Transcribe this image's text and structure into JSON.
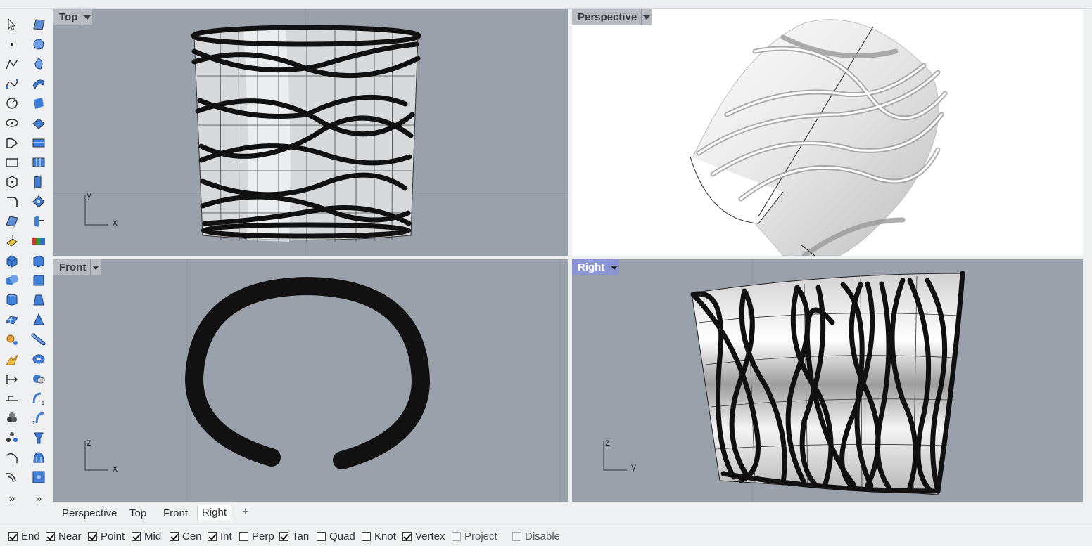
{
  "viewports": {
    "top": {
      "label": "Top",
      "axis_v": "y",
      "axis_h": "x"
    },
    "perspective": {
      "label": "Perspective"
    },
    "front": {
      "label": "Front",
      "axis_v": "z",
      "axis_h": "x"
    },
    "right": {
      "label": "Right",
      "axis_v": "z",
      "axis_h": "y"
    }
  },
  "viewport_tabs": [
    {
      "label": "Perspective",
      "active": false
    },
    {
      "label": "Top",
      "active": false
    },
    {
      "label": "Front",
      "active": false
    },
    {
      "label": "Right",
      "active": true
    }
  ],
  "add_tab_icon": "+",
  "toolbar": {
    "more_glyph": "»"
  },
  "osnaps": [
    {
      "label": "End",
      "checked": true,
      "enabled": true
    },
    {
      "label": "Near",
      "checked": true,
      "enabled": true
    },
    {
      "label": "Point",
      "checked": true,
      "enabled": true
    },
    {
      "label": "Mid",
      "checked": true,
      "enabled": true
    },
    {
      "label": "Cen",
      "checked": true,
      "enabled": true
    },
    {
      "label": "Int",
      "checked": true,
      "enabled": true
    },
    {
      "label": "Perp",
      "checked": false,
      "enabled": true
    },
    {
      "label": "Tan",
      "checked": true,
      "enabled": true
    },
    {
      "label": "Quad",
      "checked": false,
      "enabled": true
    },
    {
      "label": "Knot",
      "checked": false,
      "enabled": true
    },
    {
      "label": "Vertex",
      "checked": true,
      "enabled": true
    },
    {
      "label": "Project",
      "checked": false,
      "enabled": false
    },
    {
      "label": "Disable",
      "checked": false,
      "enabled": false
    }
  ],
  "colors": {
    "viewport_bg": "#9aa1aa",
    "active_tab": "#8b95d4",
    "grid": "#8d949c"
  }
}
